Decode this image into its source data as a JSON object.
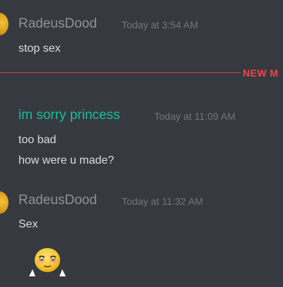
{
  "messages": [
    {
      "username": "RadeusDood",
      "timestamp": "Today at 3:54 AM",
      "lines": [
        "stop sex"
      ]
    },
    {
      "username": "im sorry princess",
      "timestamp": "Today at 11:09 AM",
      "lines": [
        "too bad",
        "how were u made?"
      ]
    },
    {
      "username": "RadeusDood",
      "timestamp": "Today at 11:32 AM",
      "lines": [
        "Sex"
      ]
    }
  ],
  "divider": {
    "label": "NEW M"
  },
  "emoji": {
    "name": "blushing-shy-emoji"
  },
  "colors": {
    "background": "#36393f",
    "username_default": "#8e9297",
    "username_teal": "#1abc9c",
    "message_text": "#dcddde",
    "timestamp": "#72767d",
    "new_divider": "#f04747"
  }
}
